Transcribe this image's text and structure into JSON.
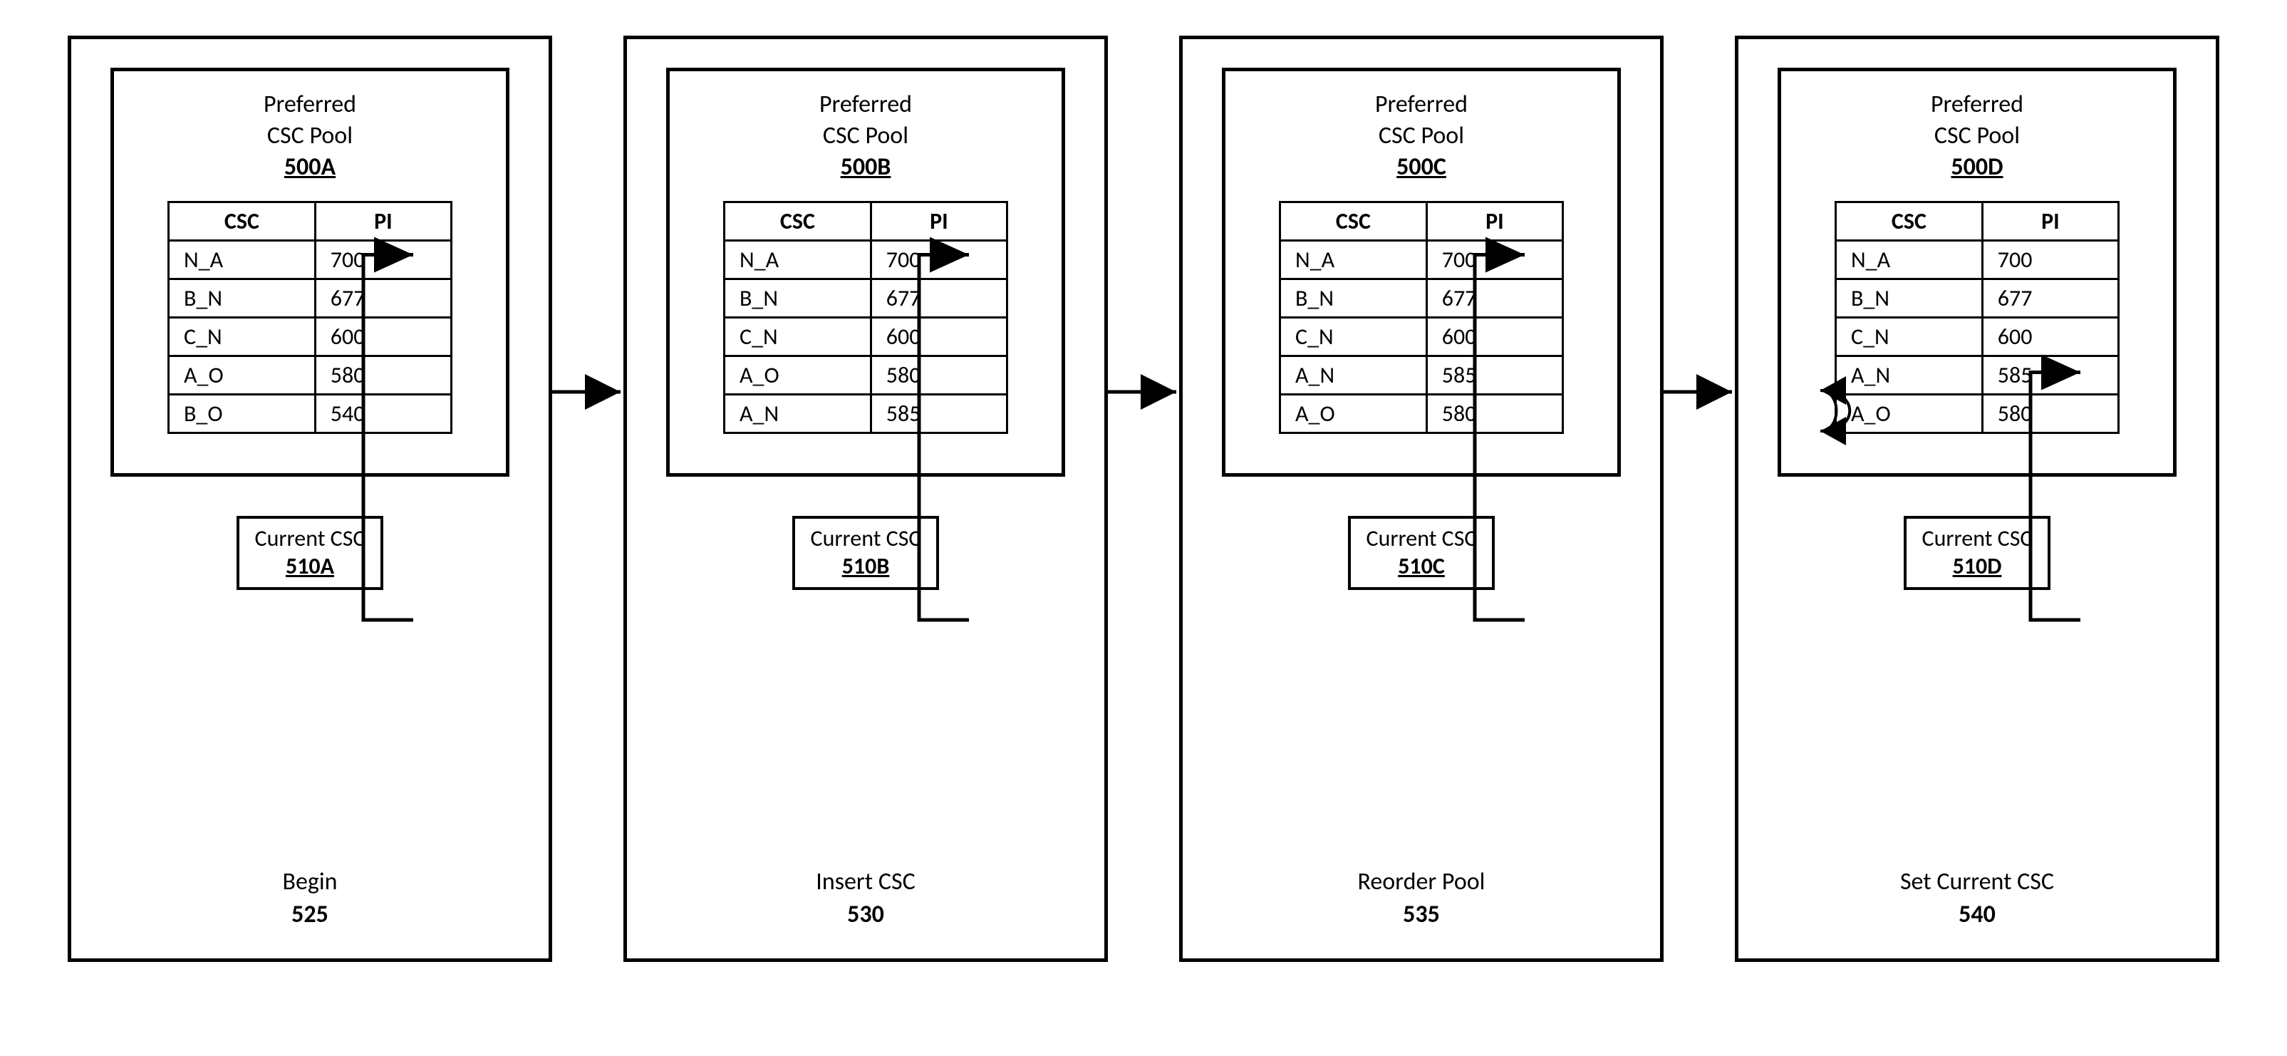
{
  "panels": [
    {
      "pool_label": "Preferred\nCSC Pool",
      "pool_id": "500A",
      "cols": [
        "CSC",
        "PI"
      ],
      "rows": [
        [
          "N_A",
          "700"
        ],
        [
          "B_N",
          "677"
        ],
        [
          "C_N",
          "600"
        ],
        [
          "A_O",
          "580"
        ],
        [
          "B_O",
          "540"
        ]
      ],
      "current_label": "Current CSC",
      "current_id": "510A",
      "caption": "Begin",
      "caption_num": "525",
      "pointer_row": 0
    },
    {
      "pool_label": "Preferred\nCSC Pool",
      "pool_id": "500B",
      "cols": [
        "CSC",
        "PI"
      ],
      "rows": [
        [
          "N_A",
          "700"
        ],
        [
          "B_N",
          "677"
        ],
        [
          "C_N",
          "600"
        ],
        [
          "A_O",
          "580"
        ],
        [
          "A_N",
          "585"
        ]
      ],
      "current_label": "Current CSC",
      "current_id": "510B",
      "caption": "Insert CSC",
      "caption_num": "530",
      "pointer_row": 0
    },
    {
      "pool_label": "Preferred\nCSC Pool",
      "pool_id": "500C",
      "cols": [
        "CSC",
        "PI"
      ],
      "rows": [
        [
          "N_A",
          "700"
        ],
        [
          "B_N",
          "677"
        ],
        [
          "C_N",
          "600"
        ],
        [
          "A_N",
          "585"
        ],
        [
          "A_O",
          "580"
        ]
      ],
      "current_label": "Current CSC",
      "current_id": "510C",
      "caption": "Reorder Pool",
      "caption_num": "535",
      "pointer_row": 0,
      "swap": true
    },
    {
      "pool_label": "Preferred\nCSC Pool",
      "pool_id": "500D",
      "cols": [
        "CSC",
        "PI"
      ],
      "rows": [
        [
          "N_A",
          "700"
        ],
        [
          "B_N",
          "677"
        ],
        [
          "C_N",
          "600"
        ],
        [
          "A_N",
          "585"
        ],
        [
          "A_O",
          "580"
        ]
      ],
      "current_label": "Current CSC",
      "current_id": "510D",
      "caption": "Set Current CSC",
      "caption_num": "540",
      "pointer_row": 3
    }
  ]
}
